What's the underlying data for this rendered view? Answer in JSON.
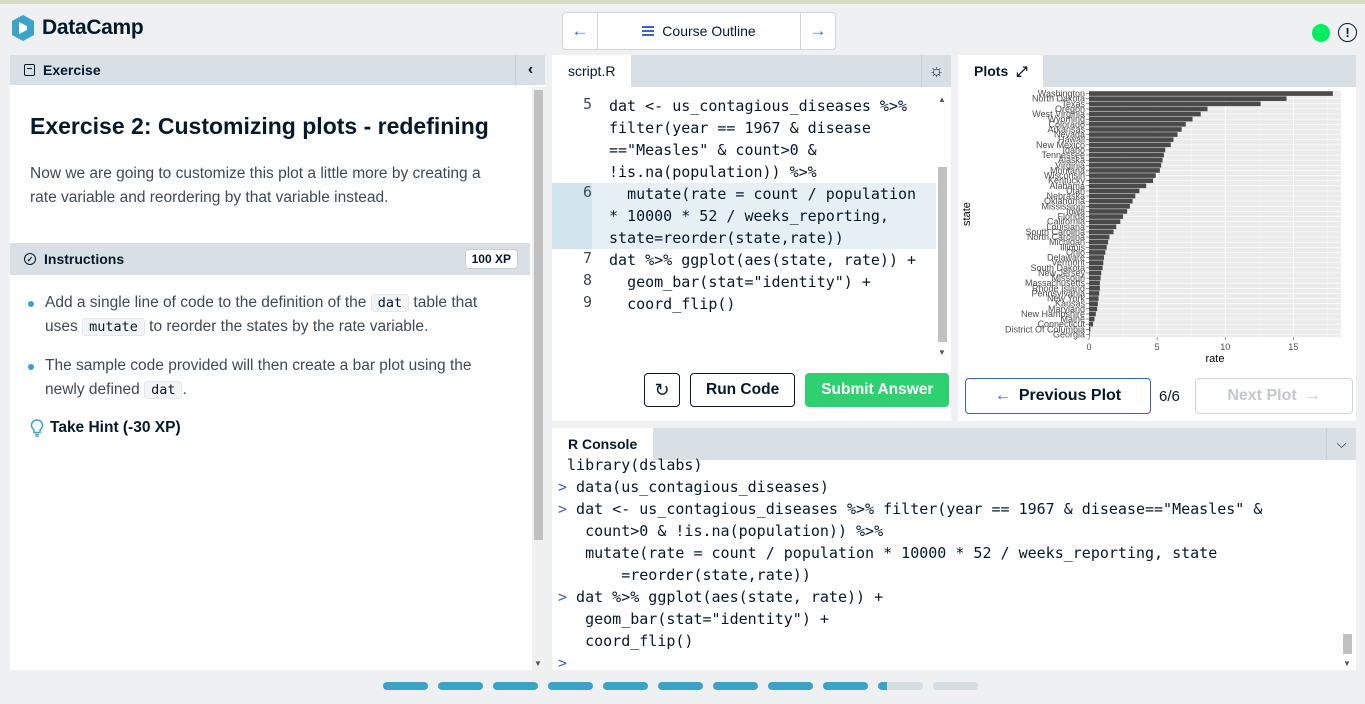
{
  "brand": {
    "name": "DataCamp"
  },
  "nav": {
    "center_label": "Course Outline",
    "prev_icon": "arrow-left-icon",
    "next_icon": "arrow-right-icon"
  },
  "status": {
    "color": "#03ef62",
    "help_label": "!"
  },
  "exercise": {
    "pane_label": "Exercise",
    "title": "Exercise 2: Customizing plots - redefining",
    "description": "Now we are going to customize this plot a little more by creating a rate variable and reordering by that variable instead.",
    "instructions_label": "Instructions",
    "xp_badge": "100 XP",
    "instructions": [
      {
        "pre": "Add a single line of code to the definition of the ",
        "code1": "dat",
        "mid": " table that uses ",
        "code2": "mutate",
        "post": " to reorder the states by the rate variable."
      },
      {
        "pre": "The sample code provided will then create a bar plot using the newly defined ",
        "code1": "dat",
        "post": "."
      }
    ],
    "hint_label": "Take Hint (-30 XP)"
  },
  "editor": {
    "tab_label": "script.R",
    "lines": [
      {
        "num": "5",
        "text": "dat <- us_contagious_diseases %>% filter(year == 1967 & disease ==\"Measles\" & count>0 & !is.na(population)) %>%",
        "active": false
      },
      {
        "num": "6",
        "text": "  mutate(rate = count / population * 10000 * 52 / weeks_reporting, state=reorder(state,rate))",
        "active": true
      },
      {
        "num": "7",
        "text": "dat %>% ggplot(aes(state, rate)) +",
        "active": false
      },
      {
        "num": "8",
        "text": "  geom_bar(stat=\"identity\") +",
        "active": false
      },
      {
        "num": "9",
        "text": "  coord_flip()",
        "active": false
      }
    ],
    "run_label": "Run Code",
    "submit_label": "Submit Answer",
    "submit_color": "#2ed16f"
  },
  "plots": {
    "tab_label": "Plots",
    "prev_label": "Previous Plot",
    "count": "6/6",
    "next_label": "Next Plot"
  },
  "chart_data": {
    "type": "bar",
    "orientation": "horizontal",
    "xlabel": "rate",
    "ylabel": "state",
    "xlim": [
      0,
      18.5
    ],
    "xticks": [
      0,
      5,
      10,
      15
    ],
    "grid": true,
    "bar_color": "#4a4a4a",
    "categories": [
      "Georgia",
      "District Of Columbia",
      "Connecticut",
      "Maine",
      "New Hampshire",
      "Maryland",
      "Kansas",
      "New York",
      "Pennsylvania",
      "Rhode Island",
      "Massachusetts",
      "Missouri",
      "New Jersey",
      "South Dakota",
      "Vermont",
      "Delaware",
      "Ohio",
      "Illinois",
      "Michigan",
      "North Carolina",
      "South Carolina",
      "Louisiana",
      "California",
      "Florida",
      "Iowa",
      "Mississippi",
      "Oklahoma",
      "Nebraska",
      "Utah",
      "Alabama",
      "Kentucky",
      "Wisconsin",
      "Montana",
      "Virginia",
      "Alaska",
      "Tennessee",
      "Idaho",
      "New Mexico",
      "Hawaii",
      "Nevada",
      "Arkansas",
      "Colorado",
      "Wyoming",
      "West Virginia",
      "Oregon",
      "Texas",
      "North Dakota",
      "Washington"
    ],
    "values": [
      0.05,
      0.1,
      0.3,
      0.4,
      0.5,
      0.6,
      0.65,
      0.7,
      0.75,
      0.8,
      0.8,
      0.85,
      0.9,
      1.0,
      1.05,
      1.1,
      1.2,
      1.3,
      1.4,
      1.5,
      1.8,
      2.0,
      2.3,
      2.5,
      2.8,
      3.0,
      3.2,
      3.4,
      3.7,
      4.2,
      4.7,
      4.9,
      5.2,
      5.3,
      5.4,
      5.5,
      5.6,
      6.0,
      6.2,
      6.5,
      6.8,
      7.1,
      7.6,
      8.2,
      8.7,
      12.6,
      14.5,
      17.9
    ]
  },
  "console": {
    "tab_label": "R Console",
    "lines": [
      {
        "prompt": "",
        "text": "library(dslabs)"
      },
      {
        "prompt": ">",
        "text": " data(us_contagious_diseases)"
      },
      {
        "prompt": ">",
        "text": " dat <- us_contagious_diseases %>% filter(year == 1967 & disease==\"Measles\" &"
      },
      {
        "prompt": "",
        "text": "   count>0 & !is.na(population)) %>%"
      },
      {
        "prompt": "",
        "text": "   mutate(rate = count / population * 10000 * 52 / weeks_reporting, state"
      },
      {
        "prompt": "",
        "text": "       =reorder(state,rate))"
      },
      {
        "prompt": ">",
        "text": " dat %>% ggplot(aes(state, rate)) +"
      },
      {
        "prompt": "",
        "text": "   geom_bar(stat=\"identity\") +"
      },
      {
        "prompt": "",
        "text": "   coord_flip()"
      },
      {
        "prompt": ">",
        "text": ""
      }
    ]
  },
  "progress": {
    "completed": 9,
    "current_fraction": 0.2,
    "total": 11
  }
}
